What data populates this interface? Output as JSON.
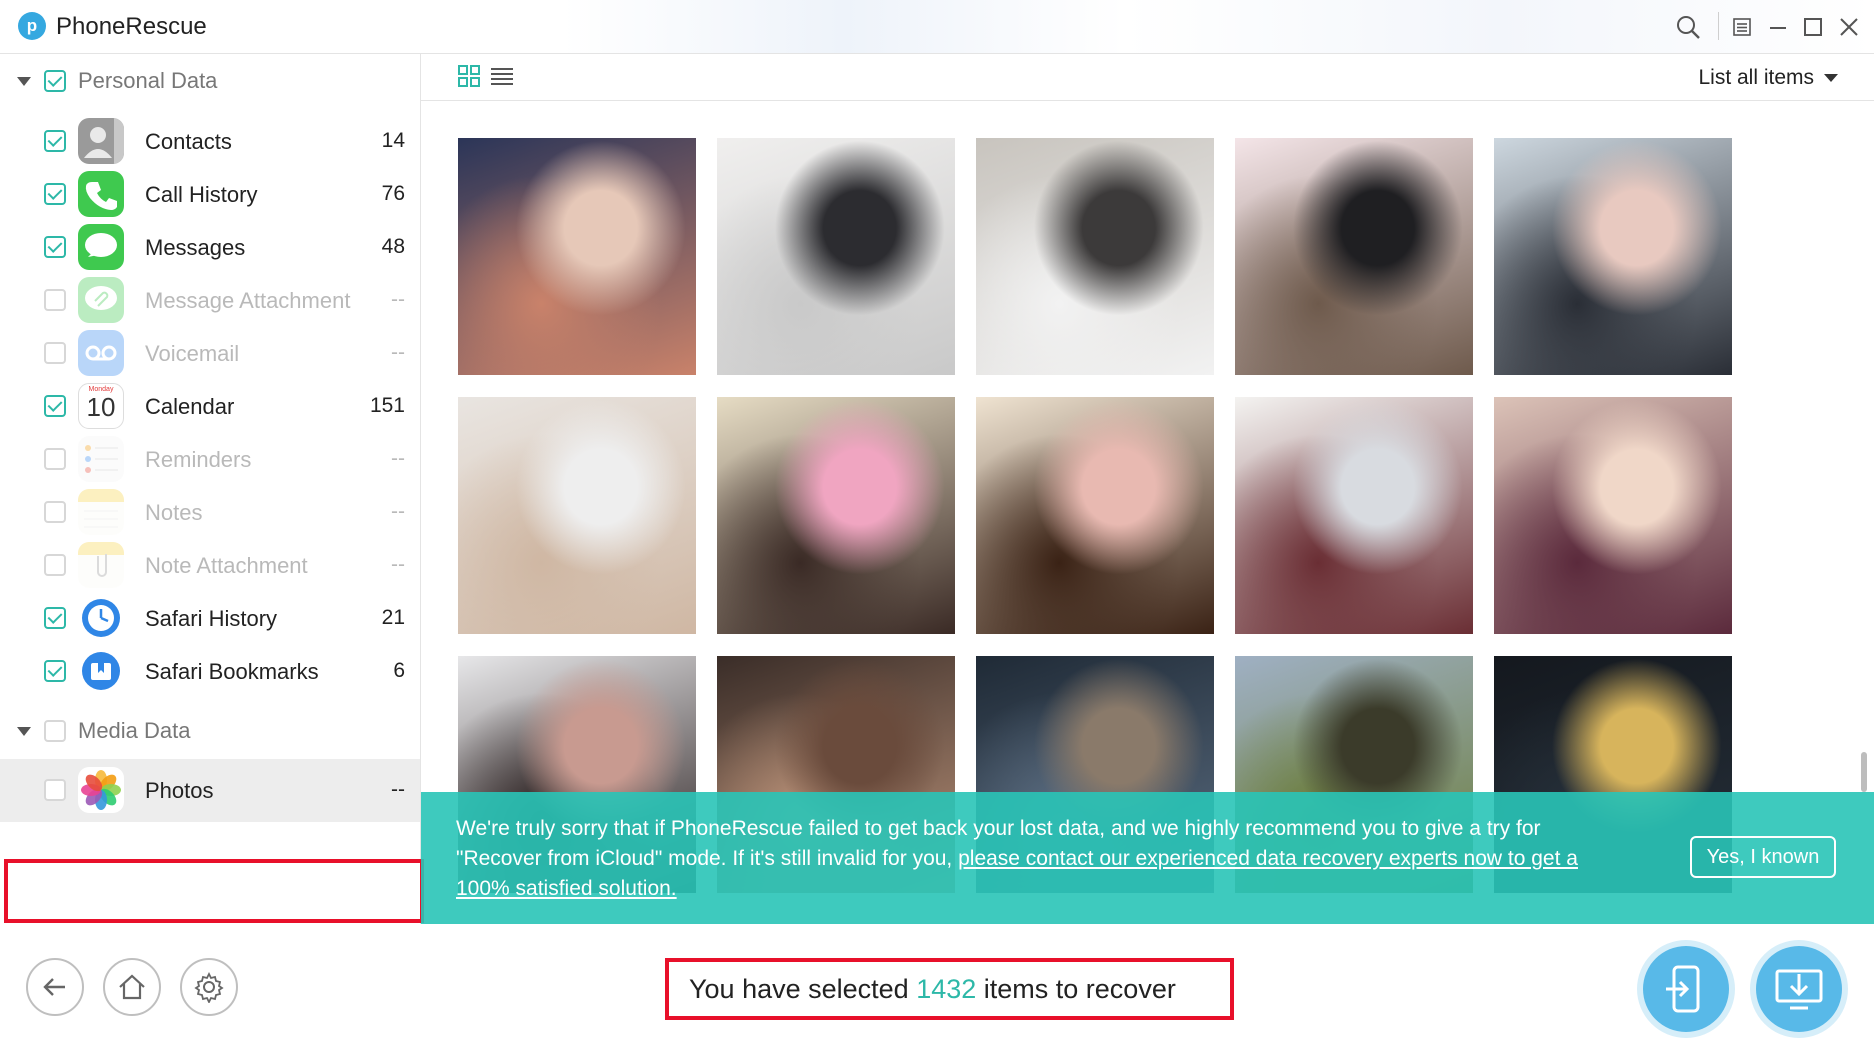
{
  "app": {
    "title": "PhoneRescue",
    "logo_letter": "p"
  },
  "toolbar": {
    "list_label": "List all items"
  },
  "sidebar": {
    "groups": [
      {
        "label": "Personal Data",
        "checked": true
      },
      {
        "label": "Media Data",
        "checked": false
      }
    ],
    "items": [
      {
        "label": "Contacts",
        "count": "14",
        "checked": true,
        "enabled": true,
        "icon": "contacts-icon"
      },
      {
        "label": "Call History",
        "count": "76",
        "checked": true,
        "enabled": true,
        "icon": "phone-icon"
      },
      {
        "label": "Messages",
        "count": "48",
        "checked": true,
        "enabled": true,
        "icon": "messages-icon"
      },
      {
        "label": "Message Attachment",
        "count": "--",
        "checked": false,
        "enabled": false,
        "icon": "message-attachment-icon"
      },
      {
        "label": "Voicemail",
        "count": "--",
        "checked": false,
        "enabled": false,
        "icon": "voicemail-icon"
      },
      {
        "label": "Calendar",
        "count": "151",
        "checked": true,
        "enabled": true,
        "icon": "calendar-icon",
        "icon_day": "10",
        "icon_weekday": "Monday"
      },
      {
        "label": "Reminders",
        "count": "--",
        "checked": false,
        "enabled": false,
        "icon": "reminders-icon"
      },
      {
        "label": "Notes",
        "count": "--",
        "checked": false,
        "enabled": false,
        "icon": "notes-icon"
      },
      {
        "label": "Note Attachment",
        "count": "--",
        "checked": false,
        "enabled": false,
        "icon": "note-attachment-icon"
      },
      {
        "label": "Safari History",
        "count": "21",
        "checked": true,
        "enabled": true,
        "icon": "safari-history-icon"
      },
      {
        "label": "Safari Bookmarks",
        "count": "6",
        "checked": true,
        "enabled": true,
        "icon": "safari-bookmarks-icon"
      }
    ],
    "media_items": [
      {
        "label": "Photos",
        "count": "--",
        "checked": false,
        "enabled": true,
        "icon": "photos-icon"
      }
    ]
  },
  "photos": [
    {
      "name": "couple-kiss-photo",
      "colors": [
        "#2b3558",
        "#c9826a",
        "#e6c8b8"
      ]
    },
    {
      "name": "bride-veil-photo",
      "colors": [
        "#f0efee",
        "#c9c9c9",
        "#2c2c30"
      ]
    },
    {
      "name": "wedding-hall-photo",
      "colors": [
        "#c8c4be",
        "#f2f2f2",
        "#3c3a3a"
      ]
    },
    {
      "name": "mirror-selfie-photo",
      "colors": [
        "#f4e5e8",
        "#6e5a4c",
        "#1f1f22"
      ]
    },
    {
      "name": "beach-couple-photo",
      "colors": [
        "#cdd7df",
        "#2a2e36",
        "#e8c9c0"
      ]
    },
    {
      "name": "family-baby-photo",
      "colors": [
        "#e9e5e1",
        "#cfb7a3",
        "#eeeeee"
      ]
    },
    {
      "name": "cartoon-cat-girl-photo",
      "colors": [
        "#e6dcc4",
        "#3a2a25",
        "#f0a5c1"
      ]
    },
    {
      "name": "cartoon-girl-braids-photo",
      "colors": [
        "#efe3d1",
        "#3a2215",
        "#e8b9b1"
      ]
    },
    {
      "name": "girls-selfie-drawing-photo",
      "colors": [
        "#f4f3f1",
        "#6a2e34",
        "#d8dbe0"
      ]
    },
    {
      "name": "hijab-drawing-photo",
      "colors": [
        "#dcc3b8",
        "#5b2a3c",
        "#f0d7c8"
      ]
    },
    {
      "name": "couple-close-photo",
      "colors": [
        "#e7e7e9",
        "#2a2020",
        "#c89a90"
      ]
    },
    {
      "name": "couple-whisper-photo",
      "colors": [
        "#3a2d28",
        "#b99178",
        "#6a4b3c"
      ]
    },
    {
      "name": "night-window-photo",
      "colors": [
        "#1f2a36",
        "#5a6c80",
        "#8a7a6a"
      ]
    },
    {
      "name": "landscape-calligraphy-photo",
      "colors": [
        "#9fb0c3",
        "#6a7c3a",
        "#3b3b2a"
      ]
    },
    {
      "name": "candle-night-photo",
      "colors": [
        "#14181e",
        "#26303a",
        "#d7b45c"
      ]
    }
  ],
  "banner": {
    "text_plain": "We're truly sorry that if PhoneRescue failed to get back your lost data, and we highly recommend you to give a try for \"Recover from iCloud\" mode. If it's still invalid for you, ",
    "link_text": "please contact our experienced data recovery experts now to get a 100% satisfied solution.",
    "button_label": "Yes, I known"
  },
  "footer": {
    "selected_prefix": "You have selected ",
    "selected_count": "1432",
    "selected_suffix": " items to recover"
  },
  "colors": {
    "accent": "#2db8a8",
    "banner": "#29c4b7",
    "highlight": "#e8102a",
    "action": "#58b9e8"
  }
}
